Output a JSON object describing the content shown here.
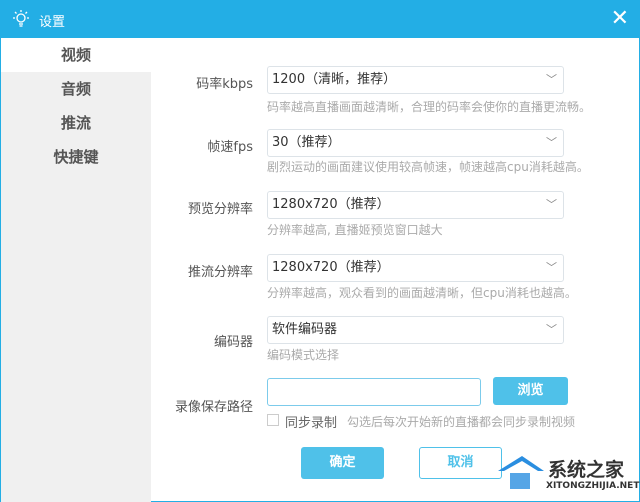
{
  "window": {
    "title": "设置",
    "accent": "#23aee5"
  },
  "sidebar": {
    "items": [
      {
        "label": "视频"
      },
      {
        "label": "音频"
      },
      {
        "label": "推流"
      },
      {
        "label": "快捷键"
      }
    ]
  },
  "form": {
    "bitrate": {
      "label": "码率kbps",
      "value": "1200（清晰，推荐）",
      "hint": "码率越高直播画面越清晰，合理的码率会使你的直播更流畅。"
    },
    "fps": {
      "label": "帧速fps",
      "value": "30（推荐）",
      "hint": "剧烈运动的画面建议使用较高帧速，帧速越高cpu消耗越高。"
    },
    "preview_res": {
      "label": "预览分辨率",
      "value": "1280x720（推荐）",
      "hint": "分辨率越高, 直播姬预览窗口越大"
    },
    "stream_res": {
      "label": "推流分辨率",
      "value": "1280x720（推荐）",
      "hint": "分辨率越高，观众看到的画面越清晰，但cpu消耗也越高。"
    },
    "encoder": {
      "label": "编码器",
      "value": "软件编码器",
      "hint": "编码模式选择"
    },
    "record_path": {
      "label": "录像保存路径",
      "value": "",
      "browse": "浏览"
    },
    "sync_record": {
      "label": "同步录制",
      "checked": false,
      "hint": "勾选后每次开始新的直播都会同步录制视频"
    }
  },
  "buttons": {
    "ok": "确定",
    "cancel": "取消"
  },
  "watermark": {
    "title": "系统之家",
    "url": "XITONGZHIJIA.NET"
  }
}
